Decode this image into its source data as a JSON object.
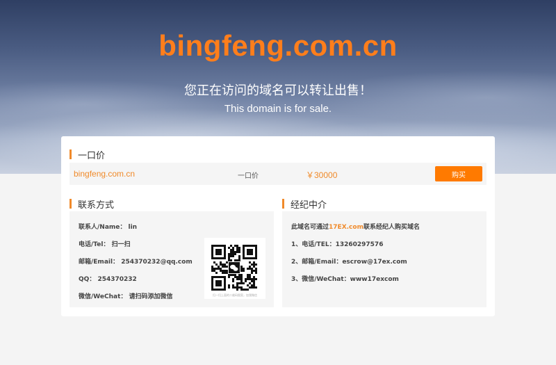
{
  "hero": {
    "domain": "bingfeng.com.cn",
    "sale_cn": "您正在访问的域名可以转让出售！",
    "sale_en": "This domain is for sale."
  },
  "price": {
    "heading": "一口价",
    "domain": "bingfeng.com.cn",
    "type": "一口价",
    "value": "￥30000",
    "buy_label": "购买"
  },
  "contact": {
    "heading": "联系方式",
    "name_label": "联系人/Name：",
    "name_value": "lin",
    "tel_label": "电话/Tel：",
    "tel_value": "扫一扫",
    "email_label": "邮箱/Email：",
    "email_value": "254370232@qq.com",
    "qq_label": "QQ：",
    "qq_value": "254370232",
    "wechat_label": "微信/WeChat：",
    "wechat_value": "请扫码添加微信",
    "qr_caption": "扫一扫上面的二维码图案，加我微信"
  },
  "broker": {
    "heading": "经纪中介",
    "intro_pre": "此域名可通过",
    "intro_link": "17EX.com",
    "intro_post": "联系经纪人购买域名",
    "tel_line": "1、电话/TEL：13260297576",
    "email_line": "2、邮箱/Email：escrow@17ex.com",
    "wechat_line": "3、微信/WeChat：www17excom"
  },
  "colors": {
    "accent": "#ff7e1b",
    "button": "#ff7a00",
    "panel_bg": "#f5f5f5"
  }
}
